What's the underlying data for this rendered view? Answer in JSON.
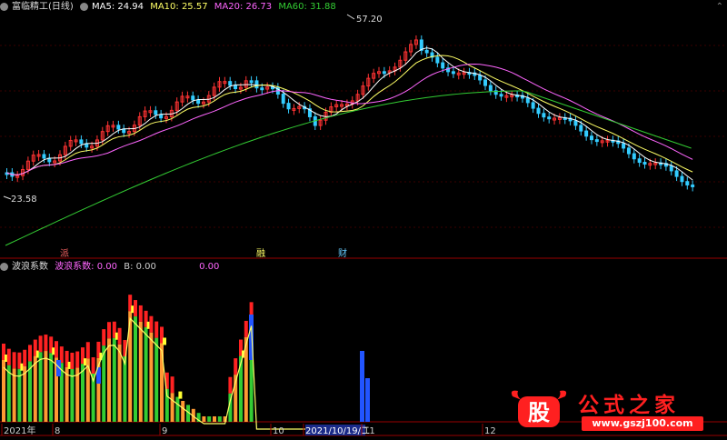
{
  "header": {
    "title": "富临精工(日线)",
    "ma5": "MA5: 24.94",
    "ma10": "MA10: 25.57",
    "ma20": "MA20: 26.73",
    "ma60": "MA60: 31.88",
    "color_ma5": "#ffffff",
    "color_ma10": "#ffff66",
    "color_ma20": "#ff66ff",
    "color_ma60": "#33cc33",
    "top_right_icon": "chevron-up-icon"
  },
  "upper_chart": {
    "high_label": "57.20",
    "low_label": "23.58",
    "markers": [
      {
        "text": "派",
        "color": "#ff6666"
      },
      {
        "text": "融",
        "color": "#ffff66"
      },
      {
        "text": "财",
        "color": "#66ccff"
      }
    ]
  },
  "indicator": {
    "name": "波浪系数",
    "label_a": "波浪系数: 0.00",
    "label_b": "B: 0.00",
    "label_c": "0.00",
    "color_a": "#ff66ff",
    "color_b": "#cccccc",
    "color_c": "#ff66ff"
  },
  "time_axis": {
    "labels": [
      "2021年",
      "8",
      "9",
      "10",
      "2021/10/19/二",
      "11",
      "12"
    ]
  },
  "watermark": {
    "logo_char": "股",
    "text": "公式之家",
    "url": "www.gszj100.com"
  }
}
